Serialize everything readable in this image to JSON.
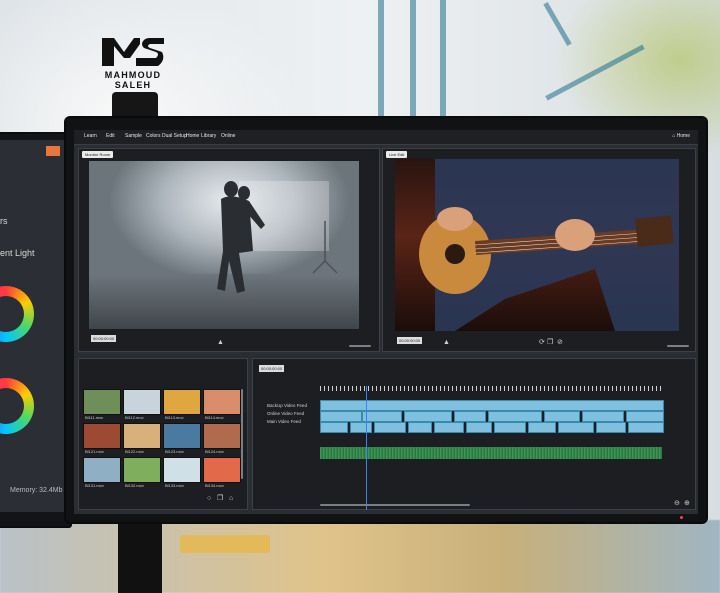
{
  "logo": {
    "text": "MAHMOUD SALEH",
    "monogram": "MS"
  },
  "left_monitor": {
    "partial_text_1": "rs",
    "partial_text_2": "ent Light",
    "memory_label": "Memory: 32.4Mb"
  },
  "menu": {
    "items": [
      "Learn",
      "Edit",
      "Sample",
      "Colors",
      "Dual Setup",
      "Home",
      "Library",
      "Online"
    ],
    "home_label": "Home"
  },
  "viewers": {
    "left_label": "Monitor Room",
    "right_label": "Live Edit",
    "left_timecode": "00:00:00:00",
    "right_timecode": "00:00:00:00"
  },
  "media_bin": {
    "thumbs": [
      {
        "label": "Bl111.mov",
        "color": "#6f8f5a"
      },
      {
        "label": "Bl112.mov",
        "color": "#c9d3db"
      },
      {
        "label": "Bl113.mov",
        "color": "#e0a640"
      },
      {
        "label": "Bl114.mov",
        "color": "#d98d6a"
      },
      {
        "label": "Bl121.mov",
        "color": "#9c4a34"
      },
      {
        "label": "Bl122.mov",
        "color": "#d8b07c"
      },
      {
        "label": "Bl123.mov",
        "color": "#4a7aa0"
      },
      {
        "label": "Bl124.mov",
        "color": "#b06a4e"
      },
      {
        "label": "Bl131.mov",
        "color": "#8fb0c4"
      },
      {
        "label": "Bl132.mov",
        "color": "#7fae5c"
      },
      {
        "label": "Bl133.mov",
        "color": "#cfe0e6"
      },
      {
        "label": "Bl134.mov",
        "color": "#e26a4a"
      }
    ]
  },
  "timeline": {
    "timecode": "00:00:00:00",
    "tracks": [
      "BackUp Video Feed",
      "Online Video Feed",
      "Main Video Feed"
    ]
  },
  "colors": {
    "clip_blue": "#7fc0de",
    "audio_green": "#4cbf68",
    "playhead": "#3b82f6"
  }
}
